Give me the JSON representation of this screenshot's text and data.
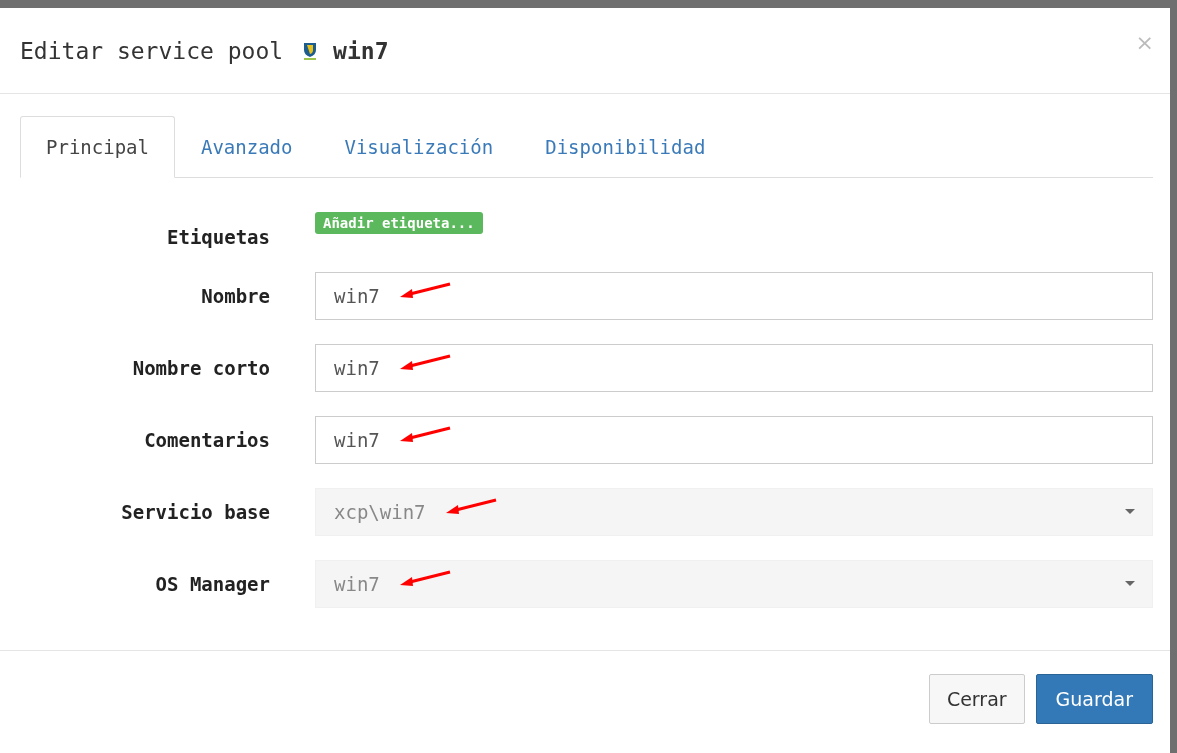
{
  "dialog": {
    "title": "Editar service pool",
    "pool_name": "win7",
    "close": "×"
  },
  "tabs": [
    {
      "label": "Principal",
      "selected": true
    },
    {
      "label": "Avanzado",
      "selected": false
    },
    {
      "label": "Visualización",
      "selected": false
    },
    {
      "label": "Disponibilidad",
      "selected": false
    }
  ],
  "tags": {
    "label": "Etiquetas",
    "button": "Añadir etiqueta..."
  },
  "fields": [
    {
      "label": "Nombre",
      "kind": "input",
      "value": "win7",
      "annotated": true
    },
    {
      "label": "Nombre corto",
      "kind": "input",
      "value": "win7",
      "annotated": true
    },
    {
      "label": "Comentarios",
      "kind": "input",
      "value": "win7",
      "annotated": true
    },
    {
      "label": "Servicio base",
      "kind": "select",
      "value": "xcp\\win7",
      "annotated": true
    },
    {
      "label": "OS Manager",
      "kind": "select",
      "value": "win7",
      "annotated": true
    }
  ],
  "buttons": [
    {
      "label": "Cerrar",
      "kind": "default"
    },
    {
      "label": "Guardar",
      "kind": "primary"
    }
  ]
}
